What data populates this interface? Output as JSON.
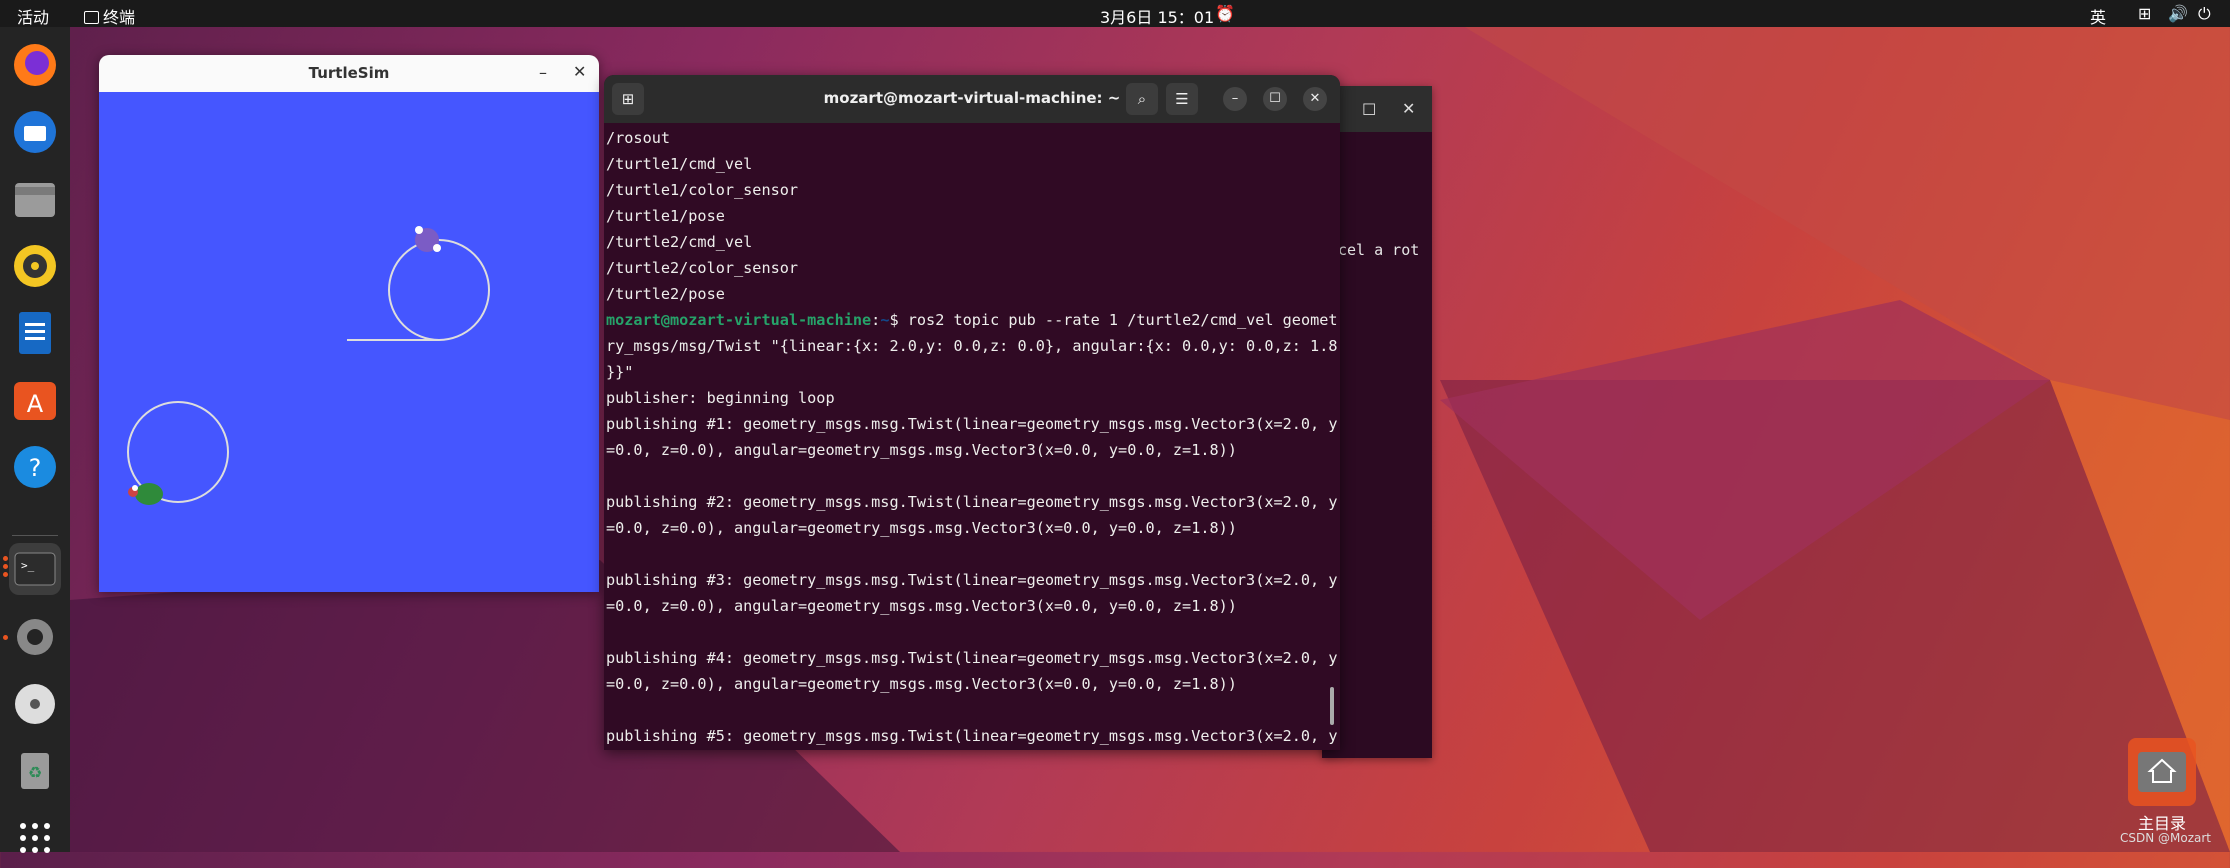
{
  "topbar": {
    "activities": "活动",
    "app": "终端",
    "clock": "3月6日 15：01",
    "input_method": "英"
  },
  "dock": {
    "items": [
      "firefox-icon",
      "thunderbird-icon",
      "files-icon",
      "rhythmbox-icon",
      "libreoffice-writer-icon",
      "app-center-icon",
      "help-icon",
      "terminal-icon",
      "settings-icon",
      "dvd-icon",
      "trash-icon",
      "show-apps-icon"
    ]
  },
  "turtlesim": {
    "title": "TurtleSim"
  },
  "terminal": {
    "title": "mozart@mozart-virtual-machine: ~",
    "lines": [
      "/rosout",
      "/turtle1/cmd_vel",
      "/turtle1/color_sensor",
      "/turtle1/pose",
      "/turtle2/cmd_vel",
      "/turtle2/color_sensor",
      "/turtle2/pose"
    ],
    "prompt_user": "mozart@mozart-virtual-machine",
    "prompt_sep": ":",
    "prompt_path": "~",
    "prompt_cmd": "$ ros2 topic pub --rate 1 /turtle2/cmd_vel geomet",
    "cmd_lines": [
      "ry_msgs/msg/Twist \"{linear:{x: 2.0,y: 0.0,z: 0.0}, angular:{x: 0.0,y: 0.0,z: 1.8",
      "}}\""
    ],
    "output": [
      "publisher: beginning loop",
      "publishing #1: geometry_msgs.msg.Twist(linear=geometry_msgs.msg.Vector3(x=2.0, y",
      "=0.0, z=0.0), angular=geometry_msgs.msg.Vector3(x=0.0, y=0.0, z=1.8))",
      "",
      "publishing #2: geometry_msgs.msg.Twist(linear=geometry_msgs.msg.Vector3(x=2.0, y",
      "=0.0, z=0.0), angular=geometry_msgs.msg.Vector3(x=0.0, y=0.0, z=1.8))",
      "",
      "publishing #3: geometry_msgs.msg.Twist(linear=geometry_msgs.msg.Vector3(x=2.0, y",
      "=0.0, z=0.0), angular=geometry_msgs.msg.Vector3(x=0.0, y=0.0, z=1.8))",
      "",
      "publishing #4: geometry_msgs.msg.Twist(linear=geometry_msgs.msg.Vector3(x=2.0, y",
      "=0.0, z=0.0), angular=geometry_msgs.msg.Vector3(x=0.0, y=0.0, z=1.8))",
      "",
      "publishing #5: geometry_msgs.msg.Twist(linear=geometry_msgs.msg.Vector3(x=2.0, y"
    ]
  },
  "back_terminal": {
    "visible_text": "cel a rot"
  },
  "desktop": {
    "home_label": "主目录",
    "watermark": "CSDN @Mozart"
  }
}
